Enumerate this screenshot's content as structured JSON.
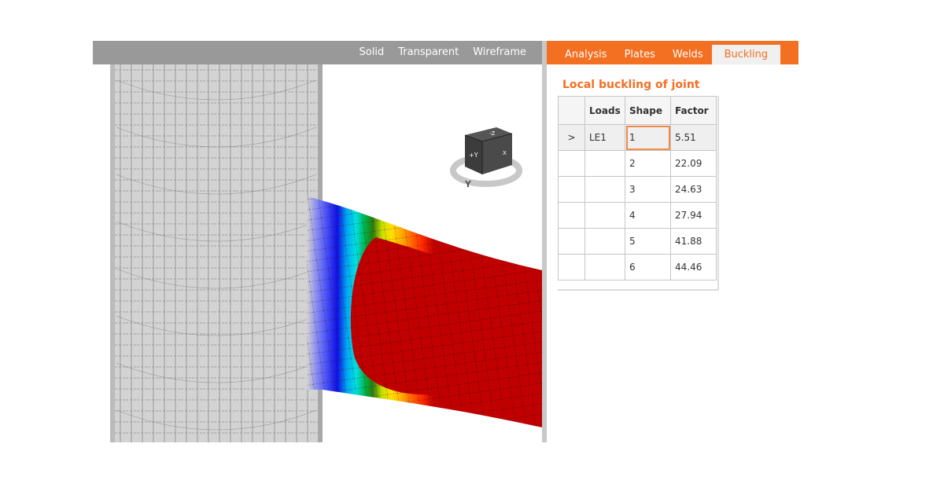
{
  "viewport": {
    "render_modes": [
      "Solid",
      "Transparent",
      "Wireframe"
    ],
    "view_cube": {
      "top_face_label": "-Z",
      "front_face_label": "+Y",
      "right_face_label": "X",
      "ring_axis_label": "Y"
    },
    "contour_colors": [
      "#d3d3d3",
      "#8a8ef0",
      "#3f48f5",
      "#1010e0",
      "#00a8f0",
      "#00e0e0",
      "#00b040",
      "#2a7a10",
      "#c8e000",
      "#ffe000",
      "#ffb000",
      "#ff7000",
      "#ff2a00",
      "#c00000"
    ]
  },
  "panel": {
    "tabs": [
      {
        "label": "Analysis",
        "active": false
      },
      {
        "label": "Plates",
        "active": false
      },
      {
        "label": "Welds",
        "active": false
      },
      {
        "label": "Buckling",
        "active": true
      }
    ],
    "section_title": "Local buckling of joint",
    "table": {
      "columns": [
        "",
        "Loads",
        "Shape",
        "Factor"
      ],
      "rows": [
        {
          "marker": ">",
          "loads": "LE1",
          "shape": "1",
          "factor": "5.51",
          "selected": true
        },
        {
          "marker": "",
          "loads": "",
          "shape": "2",
          "factor": "22.09"
        },
        {
          "marker": "",
          "loads": "",
          "shape": "3",
          "factor": "24.63"
        },
        {
          "marker": "",
          "loads": "",
          "shape": "4",
          "factor": "27.94"
        },
        {
          "marker": "",
          "loads": "",
          "shape": "5",
          "factor": "41.88"
        },
        {
          "marker": "",
          "loads": "",
          "shape": "6",
          "factor": "44.46"
        }
      ]
    }
  }
}
